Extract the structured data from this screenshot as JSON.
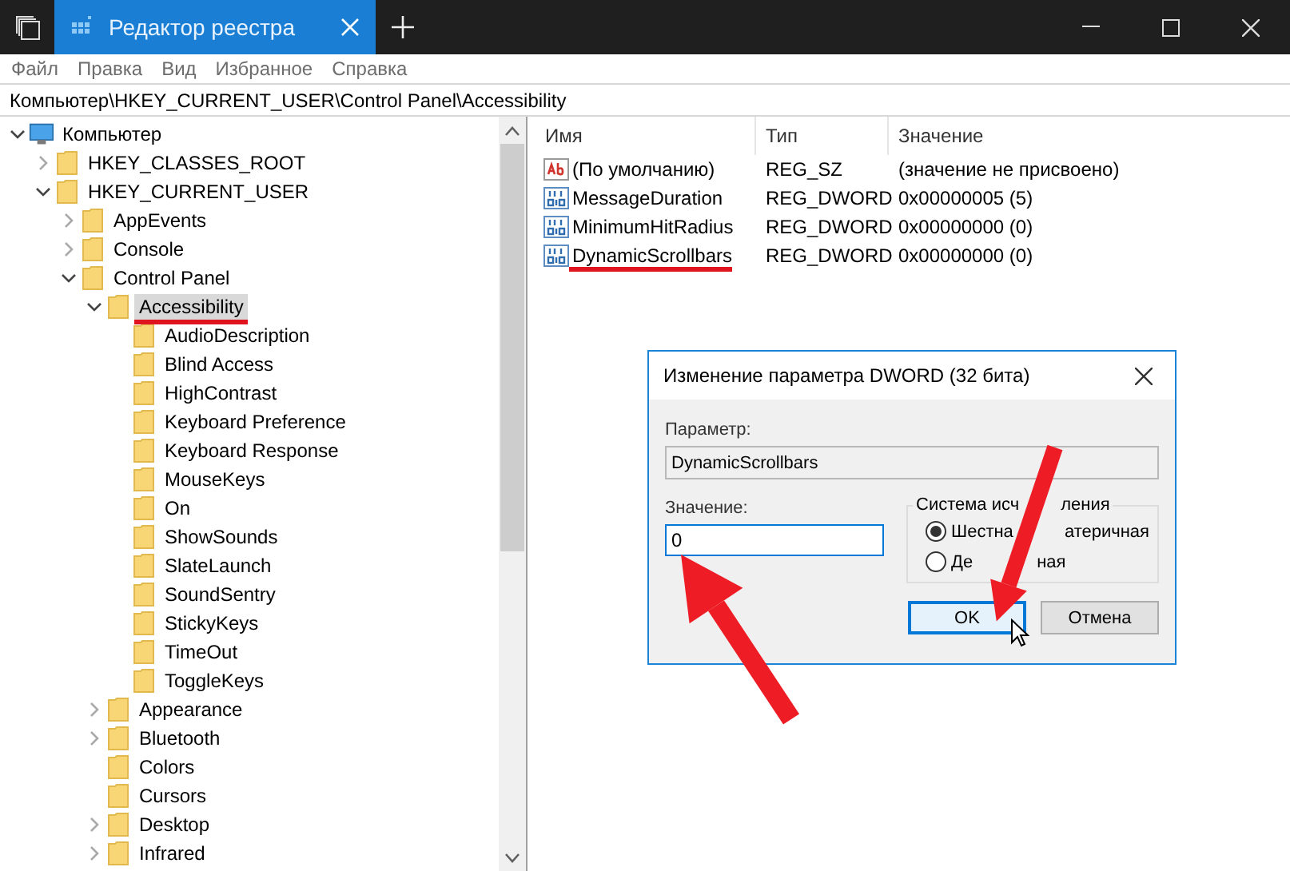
{
  "window": {
    "title": "Редактор реестра"
  },
  "menu": [
    "Файл",
    "Правка",
    "Вид",
    "Избранное",
    "Справка"
  ],
  "address": "Компьютер\\HKEY_CURRENT_USER\\Control Panel\\Accessibility",
  "tree": {
    "root": {
      "label": "Компьютер",
      "has_children": true,
      "expanded": true,
      "selected": false,
      "marked": false,
      "children": [
        {
          "label": "HKEY_CLASSES_ROOT",
          "has_children": true,
          "expanded": false,
          "selected": false,
          "marked": false
        },
        {
          "label": "HKEY_CURRENT_USER",
          "has_children": true,
          "expanded": true,
          "selected": false,
          "marked": false,
          "children": [
            {
              "label": "AppEvents",
              "has_children": true,
              "expanded": false,
              "selected": false,
              "marked": false
            },
            {
              "label": "Console",
              "has_children": true,
              "expanded": false,
              "selected": false,
              "marked": false
            },
            {
              "label": "Control Panel",
              "has_children": true,
              "expanded": true,
              "selected": false,
              "marked": false,
              "children": [
                {
                  "label": "Accessibility",
                  "has_children": true,
                  "expanded": true,
                  "selected": true,
                  "marked": true,
                  "children": [
                    {
                      "label": "AudioDescription",
                      "has_children": false,
                      "selected": false,
                      "marked": false
                    },
                    {
                      "label": "Blind Access",
                      "has_children": false,
                      "selected": false,
                      "marked": false
                    },
                    {
                      "label": "HighContrast",
                      "has_children": false,
                      "selected": false,
                      "marked": false
                    },
                    {
                      "label": "Keyboard Preference",
                      "has_children": false,
                      "selected": false,
                      "marked": false
                    },
                    {
                      "label": "Keyboard Response",
                      "has_children": false,
                      "selected": false,
                      "marked": false
                    },
                    {
                      "label": "MouseKeys",
                      "has_children": false,
                      "selected": false,
                      "marked": false
                    },
                    {
                      "label": "On",
                      "has_children": false,
                      "selected": false,
                      "marked": false
                    },
                    {
                      "label": "ShowSounds",
                      "has_children": false,
                      "selected": false,
                      "marked": false
                    },
                    {
                      "label": "SlateLaunch",
                      "has_children": false,
                      "selected": false,
                      "marked": false
                    },
                    {
                      "label": "SoundSentry",
                      "has_children": false,
                      "selected": false,
                      "marked": false
                    },
                    {
                      "label": "StickyKeys",
                      "has_children": false,
                      "selected": false,
                      "marked": false
                    },
                    {
                      "label": "TimeOut",
                      "has_children": false,
                      "selected": false,
                      "marked": false
                    },
                    {
                      "label": "ToggleKeys",
                      "has_children": false,
                      "selected": false,
                      "marked": false
                    }
                  ]
                },
                {
                  "label": "Appearance",
                  "has_children": true,
                  "expanded": false,
                  "selected": false,
                  "marked": false
                },
                {
                  "label": "Bluetooth",
                  "has_children": true,
                  "expanded": false,
                  "selected": false,
                  "marked": false
                },
                {
                  "label": "Colors",
                  "has_children": false,
                  "selected": false,
                  "marked": false
                },
                {
                  "label": "Cursors",
                  "has_children": false,
                  "selected": false,
                  "marked": false
                },
                {
                  "label": "Desktop",
                  "has_children": true,
                  "expanded": false,
                  "selected": false,
                  "marked": false
                },
                {
                  "label": "Infrared",
                  "has_children": true,
                  "expanded": false,
                  "selected": false,
                  "marked": false
                }
              ]
            }
          ]
        }
      ]
    }
  },
  "table": {
    "columns": [
      "Имя",
      "Тип",
      "Значение"
    ],
    "rows": [
      {
        "kind": "string",
        "name": "(По умолчанию)",
        "type": "REG_SZ",
        "value": "(значение не присвоено)",
        "marked": false
      },
      {
        "kind": "dword",
        "name": "MessageDuration",
        "type": "REG_DWORD",
        "value": "0x00000005 (5)",
        "marked": false
      },
      {
        "kind": "dword",
        "name": "MinimumHitRadius",
        "type": "REG_DWORD",
        "value": "0x00000000 (0)",
        "marked": false
      },
      {
        "kind": "dword",
        "name": "DynamicScrollbars",
        "type": "REG_DWORD",
        "value": "0x00000000 (0)",
        "marked": true
      }
    ]
  },
  "dialog": {
    "title": "Изменение параметра DWORD (32 бита)",
    "name_label": "Параметр:",
    "name_value": "DynamicScrollbars",
    "value_label": "Значение:",
    "value": "0",
    "base_group": {
      "legend_parts": [
        "Система исч",
        "ления"
      ],
      "options": [
        {
          "label_parts": [
            "Шестна",
            "атеричная"
          ],
          "selected": true
        },
        {
          "label_parts": [
            "Де",
            "ная"
          ],
          "selected": false
        }
      ]
    },
    "buttons": [
      {
        "label": "OK",
        "default": true
      },
      {
        "label": "Отмена",
        "default": false
      }
    ]
  }
}
